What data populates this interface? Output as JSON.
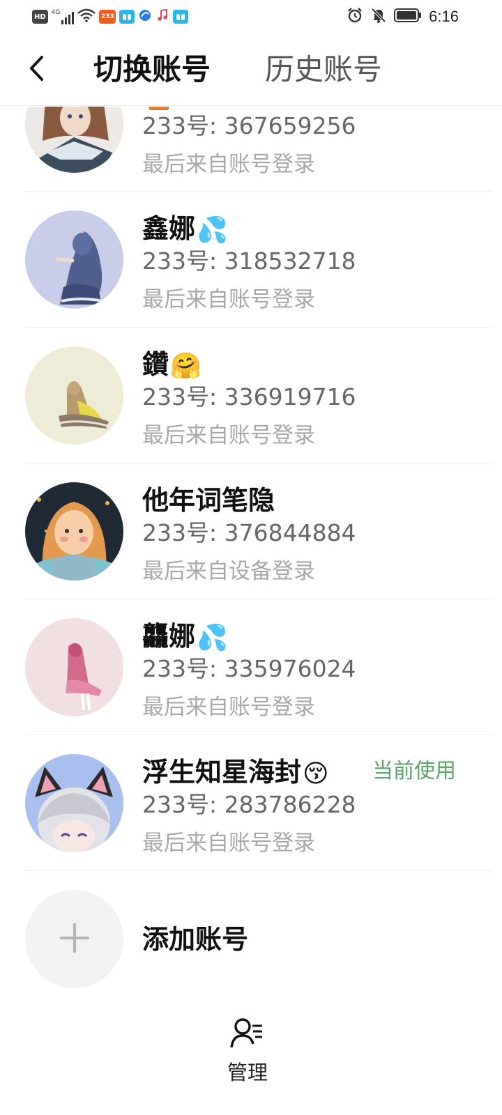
{
  "status_bar": {
    "time": "6:16",
    "left_icons": [
      "hd-badge",
      "signal-4g-icon",
      "wifi-icon",
      "app-233-icon",
      "app-book-icon",
      "app-blue-icon",
      "music-icon",
      "app-book-icon"
    ],
    "hd_text": "HD",
    "net_text": "4G",
    "chip_233": "233",
    "right_icons": [
      "alarm-icon",
      "mute-bell-icon",
      "battery-icon"
    ]
  },
  "header": {
    "back_icon": "chevron-left-icon",
    "tab_switch": "切换账号",
    "tab_history": "历史账号"
  },
  "accounts": [
    {
      "nickname": "",
      "uid": "233号: 367659256",
      "source": "最后来自账号登录",
      "current": false
    },
    {
      "nickname": "鑫娜",
      "emoji": "💦",
      "uid": "233号: 318532718",
      "source": "最后来自账号登录",
      "current": false
    },
    {
      "nickname": "鑽",
      "emoji": "🤗",
      "uid": "233号: 336919716",
      "source": "最后来自账号登录",
      "current": false
    },
    {
      "nickname": "他年词笔隐",
      "uid": "233号: 376844884",
      "source": "最后来自设备登录",
      "current": false
    },
    {
      "nickname": "龘娜",
      "emoji": "💦",
      "uid": "233号: 335976024",
      "source": "最后来自账号登录",
      "current": false
    },
    {
      "nickname": "浮生知星海封",
      "emoji": "😚",
      "uid": "233号: 283786228",
      "source": "最后来自账号登录",
      "current": true,
      "current_label": "当前使用"
    }
  ],
  "add_account": {
    "label": "添加账号",
    "icon": "plus-icon"
  },
  "bottom": {
    "manage_label": "管理",
    "manage_icon": "user-manage-icon"
  },
  "colors": {
    "current_green": "#5aa36a",
    "accent_orange": "#f07a1a"
  }
}
